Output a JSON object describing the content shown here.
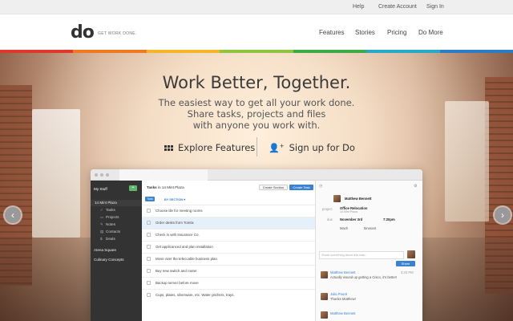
{
  "topbar": {
    "links": [
      "Help",
      "Create Account",
      "Sign In"
    ]
  },
  "nav": {
    "logo": "do",
    "tagline": "GET WORK DONE.",
    "links": [
      "Features",
      "Stories",
      "Pricing",
      "Do More"
    ]
  },
  "rainbow_colors": [
    "#e0392b",
    "#f07a22",
    "#f5b52a",
    "#8fc43f",
    "#3daa4a",
    "#27a9c8",
    "#2f7cc3"
  ],
  "hero": {
    "title": "Work Better, Together.",
    "subtitle_lines": [
      "The easiest way to get all your work done.",
      "Share tasks, projects and files",
      "with anyone you work with."
    ],
    "explore_label": "Explore Features",
    "signup_label": "Sign up for Do",
    "prev_arrow": "‹",
    "next_arrow": "›"
  },
  "app": {
    "sidebar": {
      "heading": "My Stuff",
      "plus": "+",
      "project": "14 Mint Plaza",
      "items": [
        "Tasks",
        "Projects",
        "Notes",
        "Contacts",
        "Deals"
      ],
      "groups": [
        "Atena Square",
        "Culinary Concepts"
      ]
    },
    "main": {
      "title_bold": "Tasks",
      "title_rest": " in 14 Mint Plaza",
      "create_section": "Create Section",
      "create_task": "Create Task",
      "filter": "Todo",
      "by_section": "BY SECTION ▾",
      "tasks": [
        "Choose tile for meeting rooms",
        "Order desks from Tomtix",
        "Check in with Insurance Co.",
        "Get applicanced and plan installation",
        "Move over the teleccable business plan",
        "Buy new switch and router",
        "Backup server before move",
        "Cups, plates, silverware, etc. Water pitchers, trays."
      ],
      "selected_index": 1
    },
    "detail": {
      "assignee": "Matthew Bennett",
      "project_label": "project",
      "project": "Office Relocation",
      "project_sub": "14 Mint Plaza",
      "due_label": "due",
      "due": "November 3rd",
      "time": "7:20pm",
      "tags": [
        "Mach",
        "Itinerant"
      ],
      "comment_placeholder": "Share something about this task...",
      "share": "Share",
      "comments": [
        {
          "name": "Matthew Bennett",
          "text": "Actually wound up getting a Cisco, it's better!",
          "time": "3:43 PM"
        },
        {
          "name": "Julia Pruett",
          "text": "Thanks Matthew!"
        },
        {
          "name": "Matthew Bennett"
        }
      ]
    }
  }
}
